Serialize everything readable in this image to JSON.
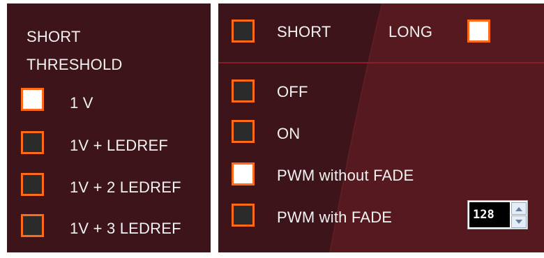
{
  "short_threshold": {
    "title": "SHORT THRESHOLD",
    "options": [
      {
        "label": "1 V",
        "checked": true
      },
      {
        "label": "1V + LEDREF",
        "checked": false
      },
      {
        "label": "1V + 2 LEDREF",
        "checked": false
      },
      {
        "label": "1V + 3 LEDREF",
        "checked": false
      }
    ]
  },
  "duration": {
    "short": {
      "label": "SHORT",
      "checked": false
    },
    "long": {
      "label": "LONG",
      "checked": true
    }
  },
  "mode": {
    "options": [
      {
        "label": "OFF",
        "checked": false
      },
      {
        "label": "ON",
        "checked": false
      },
      {
        "label": "PWM without FADE",
        "checked": true
      },
      {
        "label": "PWM with FADE",
        "checked": false
      }
    ],
    "pwm_value": "128"
  },
  "colors": {
    "panel_bg": "#3c1419",
    "checkbox_border": "#ff6a1a",
    "checkbox_unchecked": "#2b2b2b",
    "checkbox_checked": "#ffffff",
    "divider": "#8a1e26"
  },
  "icons": [
    "arrow-up-icon",
    "arrow-down-icon"
  ]
}
